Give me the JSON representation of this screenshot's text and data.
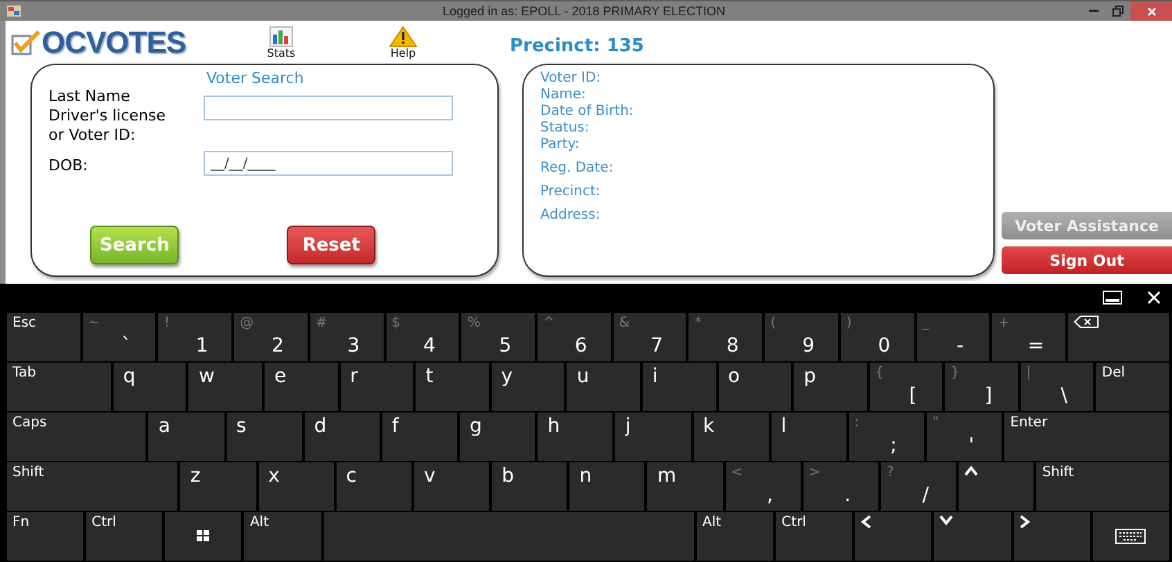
{
  "window": {
    "title": "Logged in as: EPOLL - 2018 PRIMARY ELECTION"
  },
  "header": {
    "logo": "OCVOTES",
    "toolbar": [
      {
        "label": "Stats"
      },
      {
        "label": "Help"
      }
    ],
    "precinct": "Precinct: 135"
  },
  "voter_search": {
    "title": "Voter Search",
    "id_field": {
      "label": "Last Name",
      "sublabel": "Driver's license or Voter ID:"
    },
    "dob_field": {
      "label": "DOB:",
      "value": "__/__/____"
    },
    "buttons": [
      {
        "label": "Search",
        "kind": "primary"
      },
      {
        "label": "Reset",
        "kind": "danger"
      }
    ]
  },
  "voter_details": {
    "labels": [
      "Voter ID:",
      "Name:",
      "Date of Birth:",
      "Status:",
      "Party:",
      "Reg. Date:",
      "Precinct:",
      "Address:"
    ]
  },
  "side_buttons": [
    {
      "label": "Voter Assistance",
      "disabled": true
    },
    {
      "label": "Sign Out",
      "disabled": false
    }
  ],
  "keyboard": {
    "rows": [
      {
        "keys": [
          {
            "kind": "function",
            "label": "Esc"
          },
          {
            "kind": "dual",
            "top": "~",
            "main": "`"
          },
          {
            "kind": "dual",
            "top": "!",
            "main": "1"
          },
          {
            "kind": "dual",
            "top": "@",
            "main": "2"
          },
          {
            "kind": "dual",
            "top": "#",
            "main": "3"
          },
          {
            "kind": "dual",
            "top": "$",
            "main": "4"
          },
          {
            "kind": "dual",
            "top": "%",
            "main": "5"
          },
          {
            "kind": "dual",
            "top": "^",
            "main": "6"
          },
          {
            "kind": "dual",
            "top": "&",
            "main": "7"
          },
          {
            "kind": "dual",
            "top": "*",
            "main": "8"
          },
          {
            "kind": "dual",
            "top": "(",
            "main": "9"
          },
          {
            "kind": "dual",
            "top": ")",
            "main": "0"
          },
          {
            "kind": "dual",
            "top": "_",
            "main": "-"
          },
          {
            "kind": "dual",
            "top": "+",
            "main": "="
          },
          {
            "kind": "backspace"
          }
        ]
      },
      {
        "keys": [
          {
            "kind": "function",
            "label": "Tab"
          },
          {
            "kind": "letter",
            "main": "q"
          },
          {
            "kind": "letter",
            "main": "w"
          },
          {
            "kind": "letter",
            "main": "e"
          },
          {
            "kind": "letter",
            "main": "r"
          },
          {
            "kind": "letter",
            "main": "t"
          },
          {
            "kind": "letter",
            "main": "y"
          },
          {
            "kind": "letter",
            "main": "u"
          },
          {
            "kind": "letter",
            "main": "i"
          },
          {
            "kind": "letter",
            "main": "o"
          },
          {
            "kind": "letter",
            "main": "p"
          },
          {
            "kind": "dual",
            "top": "{",
            "main": "["
          },
          {
            "kind": "dual",
            "top": "}",
            "main": "]"
          },
          {
            "kind": "dual",
            "top": "|",
            "main": "\\"
          },
          {
            "kind": "function",
            "label": "Del"
          }
        ]
      },
      {
        "keys": [
          {
            "kind": "function",
            "label": "Caps"
          },
          {
            "kind": "letter",
            "main": "a"
          },
          {
            "kind": "letter",
            "main": "s"
          },
          {
            "kind": "letter",
            "main": "d"
          },
          {
            "kind": "letter",
            "main": "f"
          },
          {
            "kind": "letter",
            "main": "g"
          },
          {
            "kind": "letter",
            "main": "h"
          },
          {
            "kind": "letter",
            "main": "j"
          },
          {
            "kind": "letter",
            "main": "k"
          },
          {
            "kind": "letter",
            "main": "l"
          },
          {
            "kind": "dual",
            "top": ":",
            "main": ";"
          },
          {
            "kind": "dual",
            "top": "\"",
            "main": "'"
          },
          {
            "kind": "function",
            "label": "Enter"
          }
        ]
      },
      {
        "keys": [
          {
            "kind": "function",
            "label": "Shift"
          },
          {
            "kind": "letter",
            "main": "z"
          },
          {
            "kind": "letter",
            "main": "x"
          },
          {
            "kind": "letter",
            "main": "c"
          },
          {
            "kind": "letter",
            "main": "v"
          },
          {
            "kind": "letter",
            "main": "b"
          },
          {
            "kind": "letter",
            "main": "n"
          },
          {
            "kind": "letter",
            "main": "m"
          },
          {
            "kind": "dual",
            "top": "<",
            "main": ","
          },
          {
            "kind": "dual",
            "top": ">",
            "main": "."
          },
          {
            "kind": "dual",
            "top": "?",
            "main": "/"
          },
          {
            "kind": "arrow-up"
          },
          {
            "kind": "function",
            "label": "Shift"
          }
        ]
      },
      {
        "keys": [
          {
            "kind": "function",
            "label": "Fn"
          },
          {
            "kind": "function",
            "label": "Ctrl"
          },
          {
            "kind": "windows"
          },
          {
            "kind": "function",
            "label": "Alt"
          },
          {
            "kind": "space"
          },
          {
            "kind": "function",
            "label": "Alt"
          },
          {
            "kind": "function",
            "label": "Ctrl"
          },
          {
            "kind": "arrow-left"
          },
          {
            "kind": "arrow-down"
          },
          {
            "kind": "arrow-right"
          },
          {
            "kind": "keyboard"
          }
        ]
      }
    ]
  }
}
